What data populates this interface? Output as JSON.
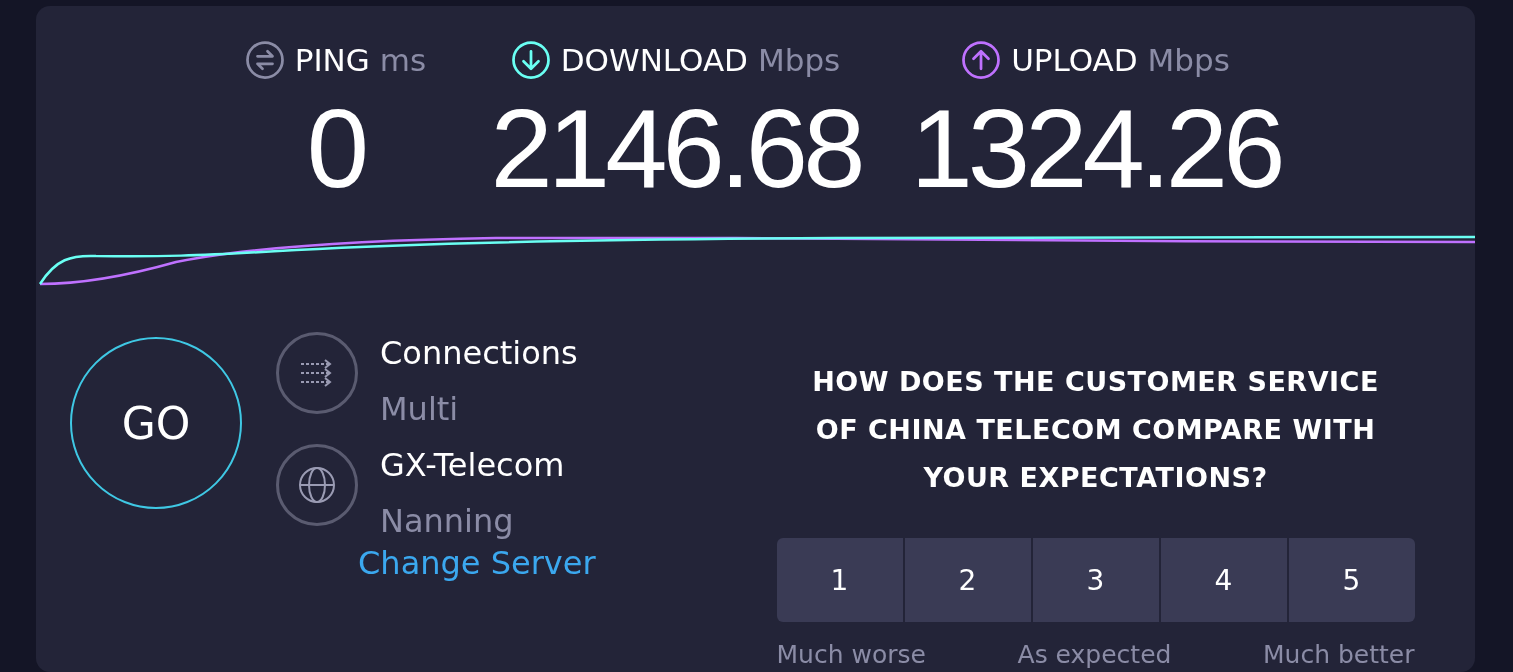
{
  "metrics": [
    {
      "kind": "ping",
      "label": "PING",
      "unit": "ms",
      "value": "0",
      "color": "#8b8ca6"
    },
    {
      "kind": "download",
      "label": "DOWNLOAD",
      "unit": "Mbps",
      "value": "2146.68",
      "color": "#6afff3"
    },
    {
      "kind": "upload",
      "label": "UPLOAD",
      "unit": "Mbps",
      "value": "1324.26",
      "color": "#bf71ff"
    }
  ],
  "go_button": "GO",
  "server_info": [
    {
      "kind": "connections",
      "title": "Connections",
      "subtitle": "Multi"
    },
    {
      "kind": "server",
      "title": "GX-Telecom",
      "subtitle": "Nanning"
    }
  ],
  "change_server_link": "Change Server",
  "survey": {
    "question": "HOW DOES THE CUSTOMER SERVICE OF CHINA TELECOM COMPARE WITH YOUR EXPECTATIONS?",
    "options": [
      "1",
      "2",
      "3",
      "4",
      "5"
    ],
    "scale_labels": [
      "Much worse",
      "As expected",
      "Much better"
    ]
  }
}
